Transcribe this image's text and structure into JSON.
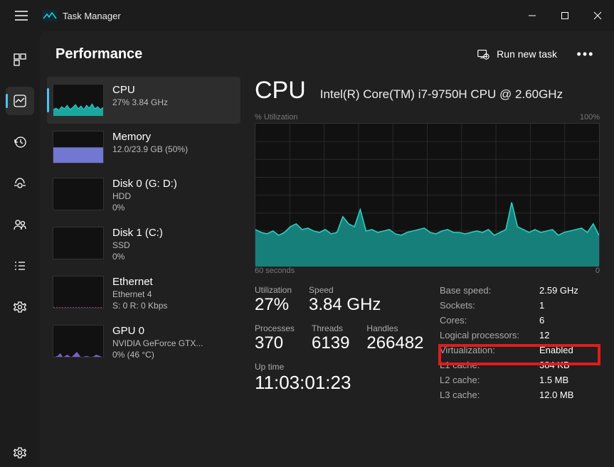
{
  "title": "Task Manager",
  "header": {
    "title": "Performance",
    "runTask": "Run new task"
  },
  "list": {
    "cpu": {
      "name": "CPU",
      "sub": "27% 3.84 GHz",
      "sub2": ""
    },
    "memory": {
      "name": "Memory",
      "sub": "12.0/23.9 GB (50%)",
      "sub2": ""
    },
    "disk0": {
      "name": "Disk 0 (G: D:)",
      "sub": "HDD",
      "sub2": "0%"
    },
    "disk1": {
      "name": "Disk 1 (C:)",
      "sub": "SSD",
      "sub2": "0%"
    },
    "eth": {
      "name": "Ethernet",
      "sub": "Ethernet 4",
      "sub2": "S: 0 R: 0 Kbps"
    },
    "gpu": {
      "name": "GPU 0",
      "sub": "NVIDIA GeForce GTX...",
      "sub2": "0% (46 °C)"
    }
  },
  "detail": {
    "title": "CPU",
    "model": "Intel(R) Core(TM) i7-9750H CPU @ 2.60GHz",
    "chartTopLeft": "% Utilization",
    "chartTopRight": "100%",
    "chartBottomLeft": "60 seconds",
    "chartBottomRight": "0",
    "big": {
      "utilLabel": "Utilization",
      "util": "27%",
      "speedLabel": "Speed",
      "speed": "3.84 GHz"
    },
    "small": {
      "procLabel": "Processes",
      "proc": "370",
      "thrLabel": "Threads",
      "thr": "6139",
      "hndLabel": "Handles",
      "hnd": "266482"
    },
    "uptimeLabel": "Up time",
    "uptime": "11:03:01:23",
    "right": [
      {
        "k": "Base speed:",
        "v": "2.59 GHz"
      },
      {
        "k": "Sockets:",
        "v": "1"
      },
      {
        "k": "Cores:",
        "v": "6"
      },
      {
        "k": "Logical processors:",
        "v": "12"
      },
      {
        "k": "Virtualization:",
        "v": "Enabled"
      },
      {
        "k": "L1 cache:",
        "v": "384 KB"
      },
      {
        "k": "L2 cache:",
        "v": "1.5 MB"
      },
      {
        "k": "L3 cache:",
        "v": "12.0 MB"
      }
    ]
  },
  "chart_data": {
    "type": "area",
    "title": "% Utilization",
    "ylim": [
      0,
      100
    ],
    "xlabel": "60 seconds → 0",
    "values": [
      26,
      24,
      23,
      25,
      22,
      24,
      28,
      30,
      26,
      27,
      25,
      24,
      26,
      23,
      24,
      35,
      30,
      28,
      40,
      25,
      26,
      24,
      25,
      26,
      23,
      22,
      24,
      25,
      26,
      27,
      24,
      23,
      25,
      26,
      24,
      24,
      23,
      24,
      25,
      24,
      26,
      22,
      24,
      26,
      45,
      28,
      26,
      24,
      26,
      24,
      25,
      26,
      22,
      24,
      25,
      26,
      27,
      24,
      30,
      22
    ]
  }
}
